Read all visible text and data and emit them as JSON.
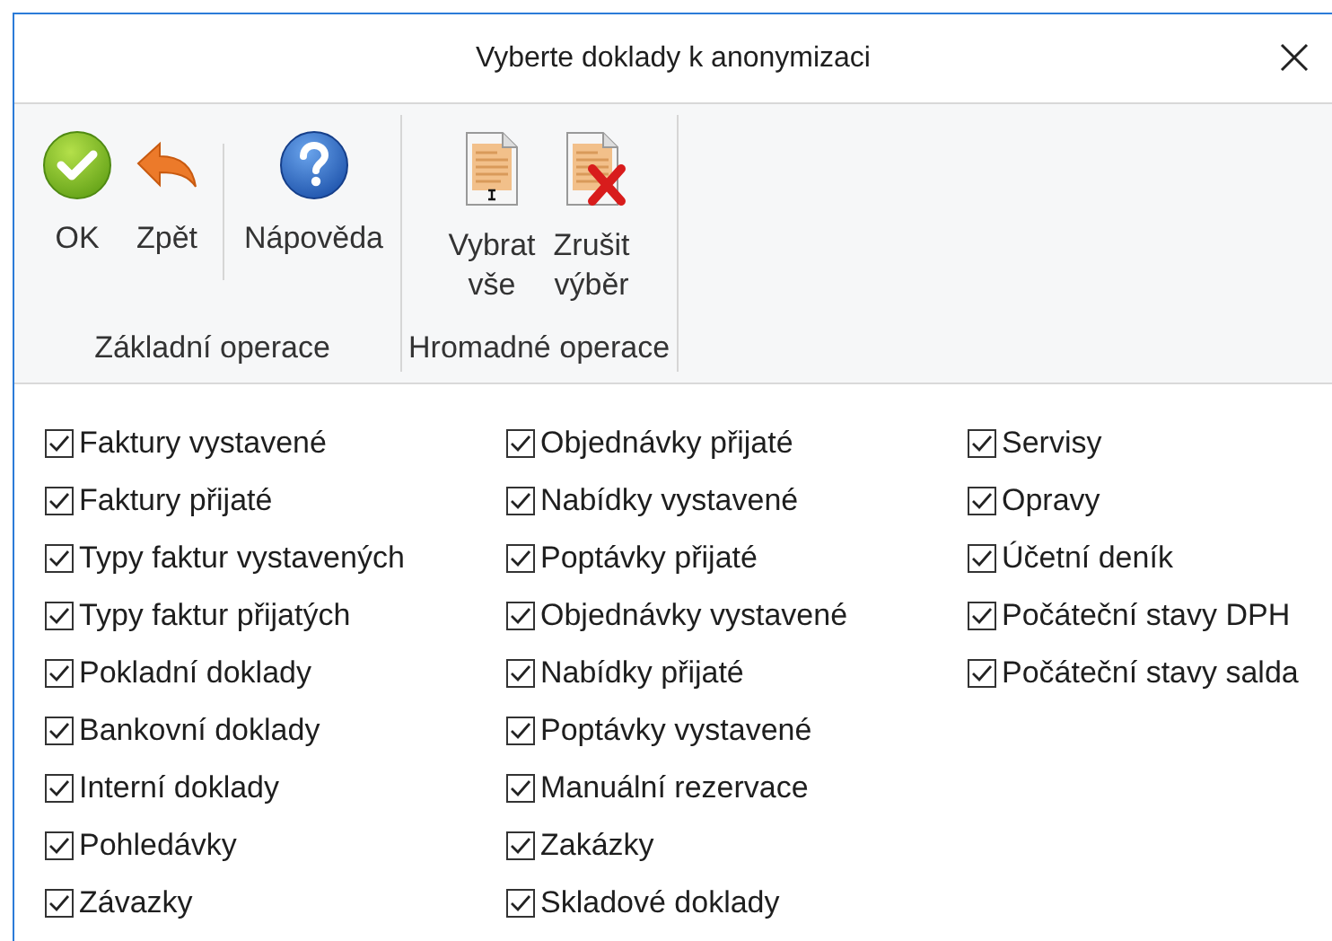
{
  "window": {
    "title": "Vyberte doklady k anonymizaci"
  },
  "toolbar_groups": [
    {
      "label": "Základní operace",
      "buttons": [
        {
          "kind": "ok",
          "lines": [
            "OK"
          ],
          "separator_before": false
        },
        {
          "kind": "back",
          "lines": [
            "Zpět"
          ],
          "separator_before": false
        },
        {
          "kind": "help",
          "lines": [
            "Nápověda"
          ],
          "separator_before": true
        }
      ]
    },
    {
      "label": "Hromadné operace",
      "buttons": [
        {
          "kind": "select-all",
          "lines": [
            "Vybrat",
            "vše"
          ],
          "separator_before": false
        },
        {
          "kind": "deselect",
          "lines": [
            "Zrušit",
            "výběr"
          ],
          "separator_before": false
        }
      ]
    }
  ],
  "columns": [
    [
      {
        "label": "Faktury vystavené",
        "checked": true
      },
      {
        "label": "Faktury přijaté",
        "checked": true
      },
      {
        "label": "Typy faktur vystavených",
        "checked": true
      },
      {
        "label": "Typy faktur přijatých",
        "checked": true
      },
      {
        "label": "Pokladní doklady",
        "checked": true
      },
      {
        "label": "Bankovní doklady",
        "checked": true
      },
      {
        "label": "Interní doklady",
        "checked": true
      },
      {
        "label": "Pohledávky",
        "checked": true
      },
      {
        "label": "Závazky",
        "checked": true
      }
    ],
    [
      {
        "label": "Objednávky přijaté",
        "checked": true
      },
      {
        "label": "Nabídky vystavené",
        "checked": true
      },
      {
        "label": "Poptávky přijaté",
        "checked": true
      },
      {
        "label": "Objednávky vystavené",
        "checked": true
      },
      {
        "label": "Nabídky přijaté",
        "checked": true
      },
      {
        "label": "Poptávky vystavené",
        "checked": true
      },
      {
        "label": "Manuální rezervace",
        "checked": true
      },
      {
        "label": "Zakázky",
        "checked": true
      },
      {
        "label": "Skladové doklady",
        "checked": true
      }
    ],
    [
      {
        "label": "Servisy",
        "checked": true
      },
      {
        "label": "Opravy",
        "checked": true
      },
      {
        "label": "Účetní deník",
        "checked": true
      },
      {
        "label": "Počáteční stavy DPH",
        "checked": true
      },
      {
        "label": "Počáteční stavy salda",
        "checked": true
      }
    ]
  ]
}
